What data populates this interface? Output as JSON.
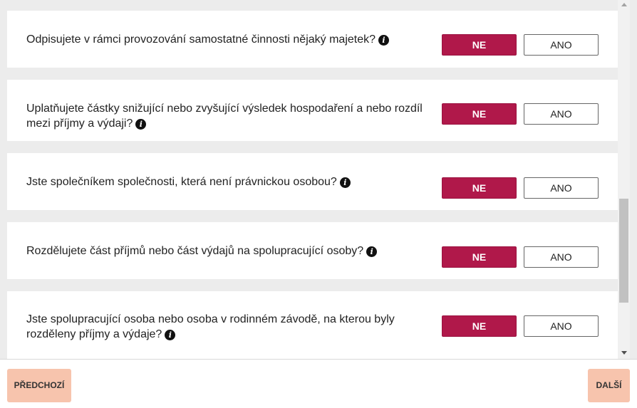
{
  "questions": [
    {
      "text": "Odpisujete v rámci provozování samostatné činnosti nějaký majetek?",
      "selected": "NE"
    },
    {
      "text": "Uplatňujete částky snižující nebo zvyšující výsledek hospodaření a nebo rozdíl mezi příjmy a výdaji?",
      "selected": "NE"
    },
    {
      "text": "Jste společníkem společnosti, která není právnickou osobou?",
      "selected": "NE"
    },
    {
      "text": "Rozdělujete část příjmů nebo část výdajů na spolupracující osoby?",
      "selected": "NE"
    },
    {
      "text": "Jste spolupracující osoba nebo osoba v rodinném závodě, na kterou byly rozděleny příjmy a výdaje?",
      "selected": "NE"
    }
  ],
  "options": {
    "no_label": "NE",
    "yes_label": "ANO"
  },
  "info_icon_glyph": "i",
  "navigation": {
    "prev_label": "PŘEDCHOZÍ",
    "next_label": "DALŠÍ"
  },
  "colors": {
    "selected_button": "#b0184a",
    "nav_button": "#f7c4ad",
    "page_background": "#ececec"
  },
  "icons": {
    "info": "info-icon"
  }
}
